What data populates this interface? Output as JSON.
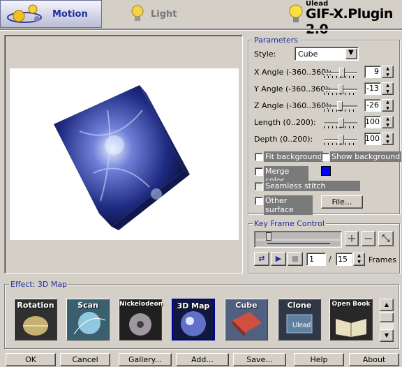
{
  "tabs": {
    "motion": "Motion",
    "light": "Light"
  },
  "brand": {
    "company": "Ulead",
    "product": "GIF-X.Plugin 2.0"
  },
  "parameters": {
    "title": "Parameters",
    "style_label": "Style:",
    "style_value": "Cube",
    "rows": [
      {
        "label": "X Angle (-360..360):",
        "value": "9",
        "slider_fraction": 0.51
      },
      {
        "label": "Y Angle (-360..360):",
        "value": "-13",
        "slider_fraction": 0.48
      },
      {
        "label": "Z Angle (-360..360):",
        "value": "-26",
        "slider_fraction": 0.46
      },
      {
        "label": "Length (0..200):",
        "value": "100",
        "slider_fraction": 0.5
      },
      {
        "label": "Depth (0..200):",
        "value": "100",
        "slider_fraction": 0.5
      }
    ],
    "fit_background": "Fit background",
    "show_background": "Show background",
    "merge_color": "Merge color",
    "merge_color_swatch": "#0000ff",
    "seamless_stitch": "Seamless stitch",
    "other_surface": "Other surface",
    "file_button": "File..."
  },
  "keyframe": {
    "title": "Key Frame Control",
    "current_frame": "1",
    "separator": "/",
    "total_frames": "15",
    "frames_label": "Frames"
  },
  "effect": {
    "title": "Effect: 3D Map",
    "items": [
      "Rotation",
      "Scan",
      "Nickelodeon",
      "3D Map",
      "Cube",
      "Clone",
      "Open Book"
    ],
    "selected": "3D Map",
    "clone_logo": "Ulead"
  },
  "buttons": {
    "ok": "OK",
    "cancel": "Cancel",
    "gallery": "Gallery...",
    "add": "Add...",
    "save": "Save...",
    "help": "Help",
    "about": "About"
  },
  "colors": {
    "accent": "#1f2f9e",
    "selection": "#0000a0",
    "dialog": "#d4d0c8"
  }
}
